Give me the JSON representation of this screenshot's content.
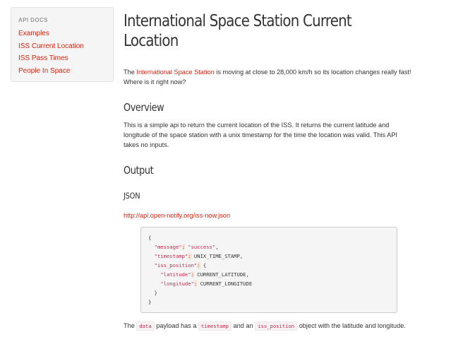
{
  "sidebar": {
    "heading": "API DOCS",
    "items": [
      {
        "label": "Examples"
      },
      {
        "label": "ISS Current Location"
      },
      {
        "label": "ISS Pass Times"
      },
      {
        "label": "People In Space"
      }
    ]
  },
  "page": {
    "title": "International Space Station Current Location",
    "intro": {
      "before": "The ",
      "link": "International Space Station",
      "after": " is moving at close to 28,000 km/h so its location changes really fast! Where is it right now?"
    },
    "overview": {
      "heading": "Overview",
      "text": "This is a simple api to return the current location of the ISS. It returns the current latitude and longitude of the space station with a unix timestamp for the time the location was valid. This API takes no inputs."
    },
    "output": {
      "heading": "Output",
      "json_heading": "JSON",
      "endpoint": "http://api.open-notify.org/iss-now.json",
      "code": {
        "open": "{",
        "message_key": "\"message\"",
        "message_value": "\"success\"",
        "timestamp_key": "\"timestamp\"",
        "timestamp_value": "UNIX_TIME_STAMP,",
        "iss_key": "\"iss_position\"",
        "iss_open": "{",
        "lat_key": "\"latitude\"",
        "lat_value": "CURRENT_LATITUDE,",
        "lon_key": "\"longitude\"",
        "lon_value": "CURRENT_LONGITUDE",
        "iss_close": "}",
        "close": "}"
      },
      "footer": {
        "t1": "The ",
        "c1": "data",
        "t2": " payload has a ",
        "c2": "timestamp",
        "t3": " and an ",
        "c3": "iss_position",
        "t4": " object with the latitude and longitude."
      }
    }
  }
}
